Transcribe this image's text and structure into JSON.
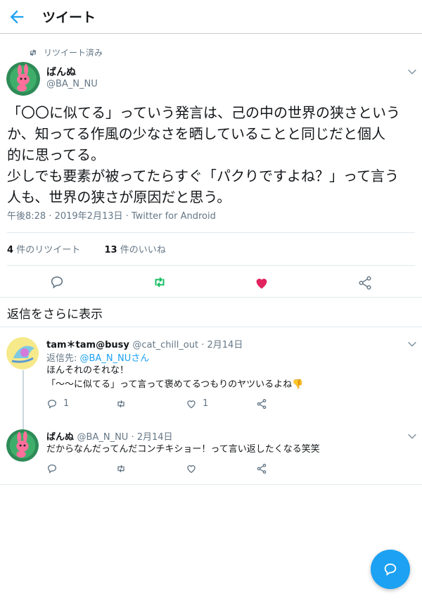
{
  "header": {
    "title": "ツイート"
  },
  "tweet": {
    "retweeted_label": "リツイート済み",
    "author_name": "ばんぬ",
    "author_handle": "@BA_N_NU",
    "text": "「〇〇に似てる」っていう発言は、己の中の世界の狭さという\nか、知ってる作風の少なさを晒していることと同じだと個人\n的に思ってる。\n少しでも要素が被ってたらすぐ「パクりですよね？」って言う\n人も、世界の狭さが原因だと思う。",
    "meta": "午後8:28 · 2019年2月13日 · Twitter for Android",
    "retweet_count": "4",
    "retweet_label": "件のリツイート",
    "like_count": "13",
    "like_label": "件のいいね"
  },
  "show_more_replies": "返信をさらに表示",
  "replies": [
    {
      "name": "tam＊tam@busy",
      "handle": "@cat_chill_out",
      "date": "· 2月14日",
      "reply_to_prefix": "返信先: ",
      "reply_to_link": "@BA_N_NUさん",
      "text": "ほんそれのそれな！\n「〜〜に似てる」って言って褒めてるつもりのヤツいるよね👎",
      "reply_count": "1",
      "like_count": "1"
    },
    {
      "name": "ばんぬ",
      "handle": "@BA_N_NU",
      "date": "· 2月14日",
      "text": "だからなんだってんだコンチキショー！って言い返したくなる笑笑"
    }
  ],
  "colors": {
    "accent": "#1da1f2",
    "retweet_green": "#17bf63",
    "like_red": "#e0245e",
    "muted": "#657786"
  }
}
